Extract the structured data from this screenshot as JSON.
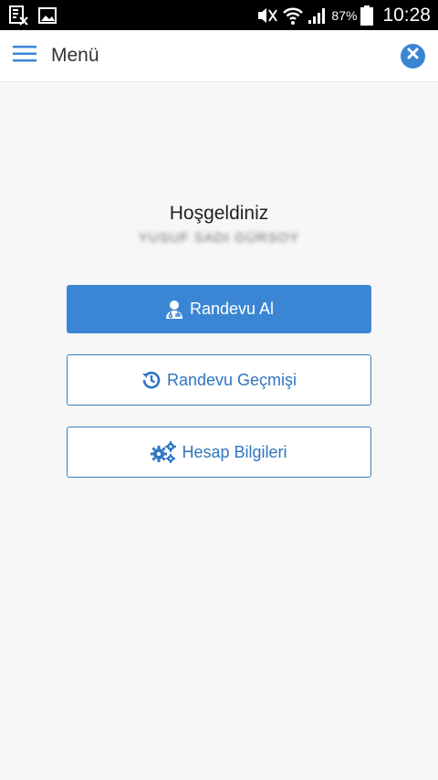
{
  "status_bar": {
    "battery_percent": "87%",
    "time": "10:28",
    "icons": [
      "rx-notification-icon",
      "image-notification-icon",
      "mute-icon",
      "wifi-icon",
      "signal-icon",
      "battery-icon"
    ]
  },
  "header": {
    "title": "Menü",
    "menu_icon": "hamburger-icon",
    "close_icon": "close-circle-icon"
  },
  "main": {
    "welcome": "Hoşgeldiniz",
    "username": "YUSUF SADI GÜRSOY",
    "buttons": [
      {
        "label": "Randevu Al",
        "icon": "doctor-icon"
      },
      {
        "label": "Randevu Geçmişi",
        "icon": "history-icon"
      },
      {
        "label": "Hesap Bilgileri",
        "icon": "gears-icon"
      }
    ]
  },
  "colors": {
    "accent": "#3b86d4",
    "accent_text": "#2f75c0",
    "background": "#f7f7f7",
    "status_bar": "#000000"
  }
}
